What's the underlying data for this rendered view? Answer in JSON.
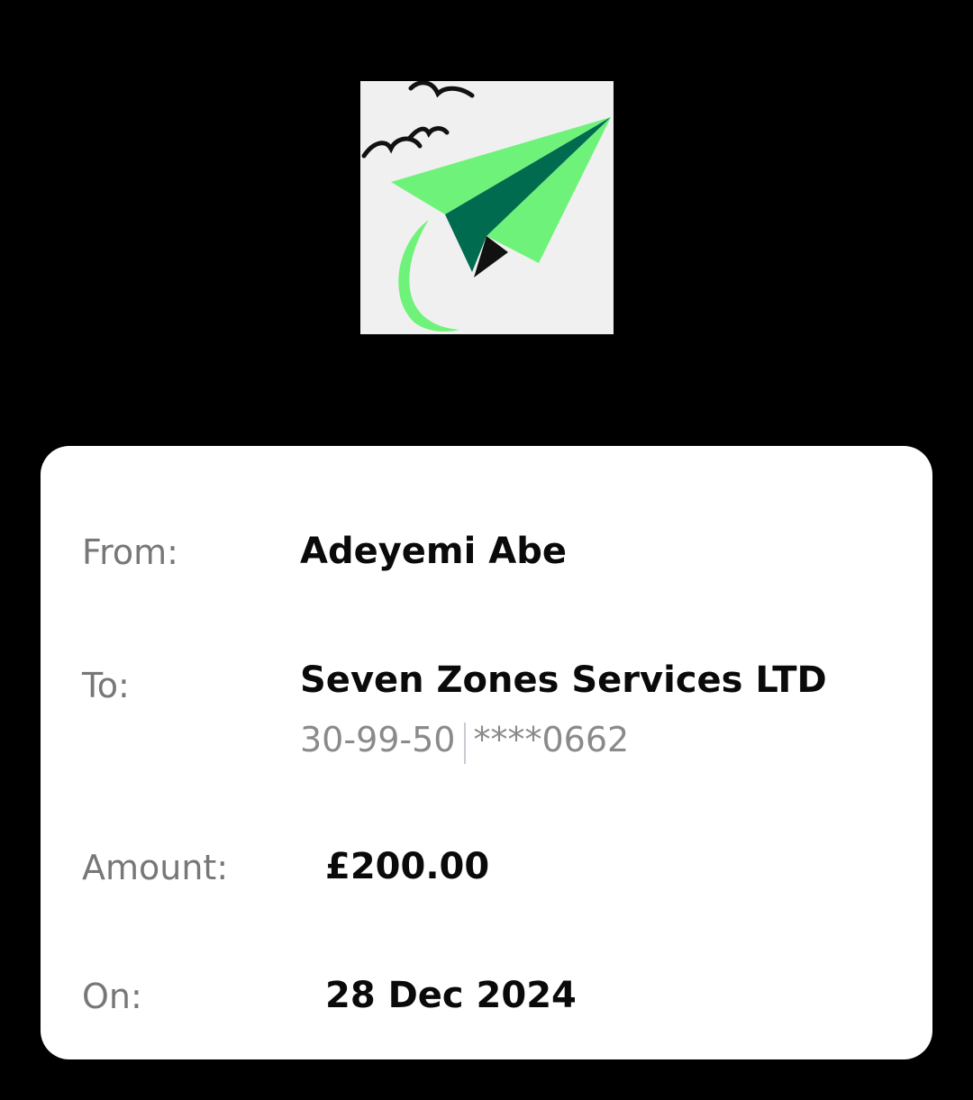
{
  "logo": {
    "icon": "paper-plane-birds-logo",
    "colors": {
      "background": "#f0f0f0",
      "light_green": "#6ff27a",
      "dark_green": "#006b4e",
      "birds": "#111111"
    }
  },
  "receipt": {
    "from": {
      "label": "From:",
      "value": "Adeyemi Abe"
    },
    "to": {
      "label": "To:",
      "value": "Seven Zones Services LTD",
      "sort_code": "30-99-50",
      "account": "****0662"
    },
    "amount": {
      "label": "Amount:",
      "value": "£200.00"
    },
    "on": {
      "label": "On:",
      "value": "28 Dec 2024"
    }
  }
}
